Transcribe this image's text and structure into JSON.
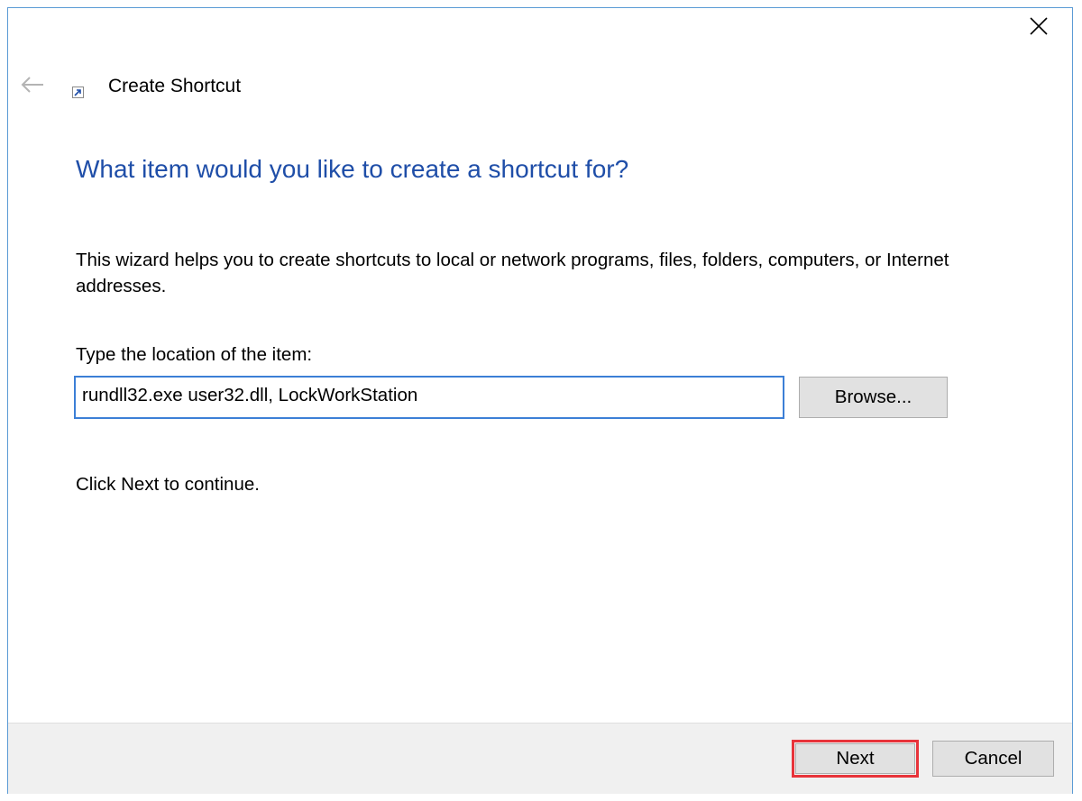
{
  "window": {
    "title": "Create Shortcut"
  },
  "icons": {
    "close": "close-icon",
    "back": "back-arrow-icon",
    "shortcut": "shortcut-icon"
  },
  "main": {
    "heading": "What item would you like to create a shortcut for?",
    "description": "This wizard helps you to create shortcuts to local or network programs, files, folders, computers, or Internet addresses.",
    "location_label": "Type the location of the item:",
    "location_value": "rundll32.exe user32.dll, LockWorkStation",
    "browse_label": "Browse...",
    "continue_text": "Click Next to continue."
  },
  "footer": {
    "next_label": "Next",
    "cancel_label": "Cancel"
  },
  "colors": {
    "heading": "#1f4ea8",
    "window_border": "#5b9bd5",
    "input_border": "#3c7fd6",
    "highlight": "#e8333a",
    "footer_bg": "#f0f0f0"
  }
}
